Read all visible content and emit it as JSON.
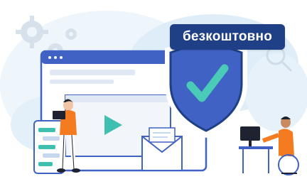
{
  "badge": {
    "label": "безкоштовно"
  },
  "colors": {
    "shield_blue": "#3f62c4",
    "shield_dark": "#1f3f86",
    "checkmark_teal": "#49cbb8",
    "play_teal": "#3fbfb0",
    "accent_orange": "#f47b20",
    "background_blob": "#dfeef8"
  },
  "icons": [
    "gear-icon",
    "shield-check-icon",
    "play-icon",
    "envelope-icon",
    "magnifier-icon"
  ]
}
